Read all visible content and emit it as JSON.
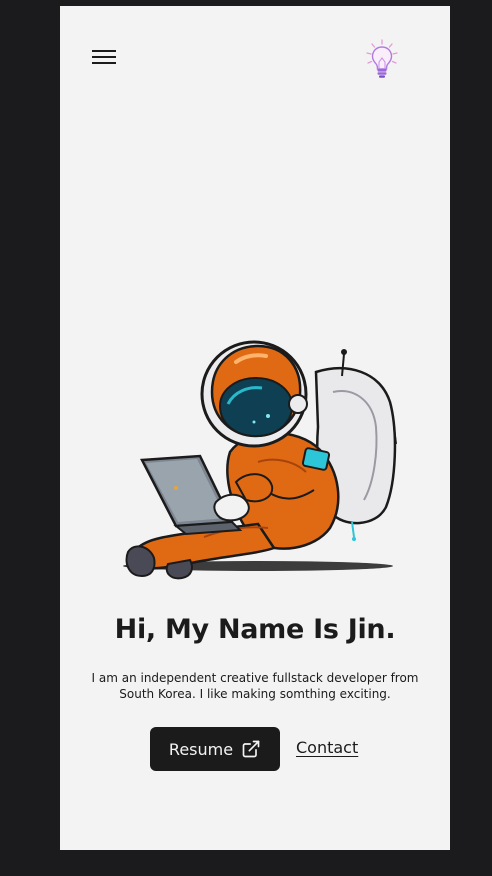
{
  "nav": {
    "menu_icon": "hamburger-menu-icon",
    "theme_icon": "lightbulb-icon"
  },
  "hero": {
    "illustration": "astronaut-with-laptop",
    "headline": "Hi, My Name Is Jin.",
    "intro": "I am an independent creative fullstack developer from South Korea. I like making somthing exciting."
  },
  "actions": {
    "resume_label": "Resume",
    "resume_icon": "external-link-icon",
    "contact_label": "Contact"
  },
  "colors": {
    "background": "#1b1b1d",
    "page": "#f3f3f3",
    "text": "#1b1b1b",
    "accent": "#b07ae0",
    "suit": "#e06a14"
  }
}
